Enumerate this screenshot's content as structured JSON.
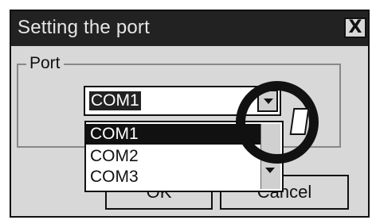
{
  "dialog": {
    "title": "Setting the port",
    "close_label": "X"
  },
  "group": {
    "label": "Port"
  },
  "combo": {
    "selected_value": "COM1",
    "dropdown_icon": "chevron-down-icon",
    "options": [
      "COM1",
      "COM2",
      "COM3"
    ],
    "highlighted_index": 0
  },
  "buttons": {
    "ok_label": "OK",
    "cancel_label": "Cancel"
  },
  "colors": {
    "titlebar": "#222222",
    "window": "#d8d8d8",
    "selection": "#111111"
  }
}
